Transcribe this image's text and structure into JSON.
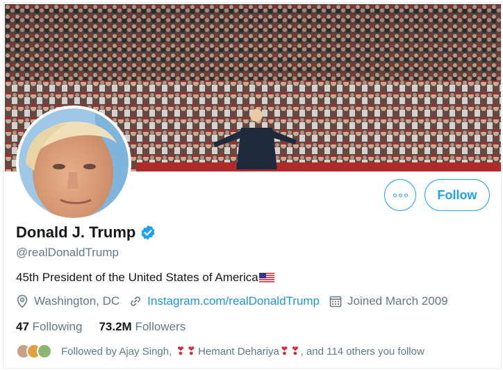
{
  "profile": {
    "name": "Donald J. Trump",
    "handle": "@realDonaldTrump",
    "bio": "45th President of the United States of America",
    "location": "Washington, DC",
    "website": "Instagram.com/realDonaldTrump",
    "joined": "Joined March 2009",
    "verified": true
  },
  "counts": {
    "following_value": "47",
    "following_label": "Following",
    "followers_value": "73.2M",
    "followers_label": "Followers"
  },
  "actions": {
    "follow_label": "Follow",
    "more_icon": "more-horizontal-icon"
  },
  "followed_by": {
    "prefix": "Followed by Ajay Singh,",
    "second_name": "Hemant Dehariya",
    "suffix": ", and 114 others you follow"
  },
  "icons": {
    "location": "location-pin-icon",
    "website": "link-icon",
    "joined": "calendar-icon",
    "verified": "verified-badge-icon",
    "flag": "us-flag-icon",
    "heart": "red-heart-icon"
  },
  "colors": {
    "accent": "#1da1f2",
    "link": "#1b95e0",
    "secondary_text": "#657786",
    "primary_text": "#14171a"
  }
}
